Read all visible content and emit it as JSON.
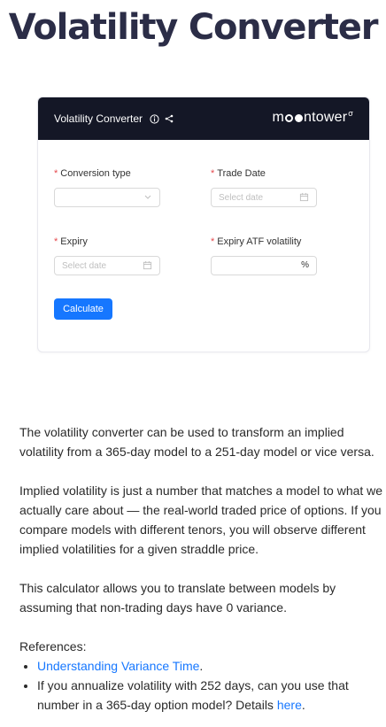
{
  "page": {
    "title": "Volatility Converter"
  },
  "card": {
    "header_title": "Volatility Converter",
    "brand": {
      "prefix": "m",
      "suffix": "ntower",
      "sup": "σ"
    },
    "fields": {
      "conversion_type": {
        "label": "Conversion type",
        "value": ""
      },
      "trade_date": {
        "label": "Trade Date",
        "placeholder": "Select date"
      },
      "expiry": {
        "label": "Expiry",
        "placeholder": "Select date"
      },
      "expiry_atf_vol": {
        "label": "Expiry ATF volatility",
        "suffix": "%"
      }
    },
    "required_mark": "*",
    "calculate_label": "Calculate"
  },
  "article": {
    "p1": "The volatility converter can be used to transform an implied volatility from a 365-day model to a 251-day model or vice versa.",
    "p2": "Implied volatility is just a number that matches a model to what we actually care about — the real-world traded price of options. If you compare models with different tenors, you will observe different implied volatilities for a given straddle price.",
    "p3": "This calculator allows you to translate between models by assuming that non-trading days have 0 variance.",
    "refs_label": "References:",
    "ref1_link": "Understanding Variance Time",
    "ref1_tail": ".",
    "ref2_text": "If you annualize volatility with 252 days, can you use that number in a 365-day option model? Details ",
    "ref2_link": "here",
    "ref2_tail": "."
  },
  "colors": {
    "header_bg": "#141726",
    "accent": "#1677ff",
    "required": "#e5484d",
    "title": "#2b2d47"
  }
}
